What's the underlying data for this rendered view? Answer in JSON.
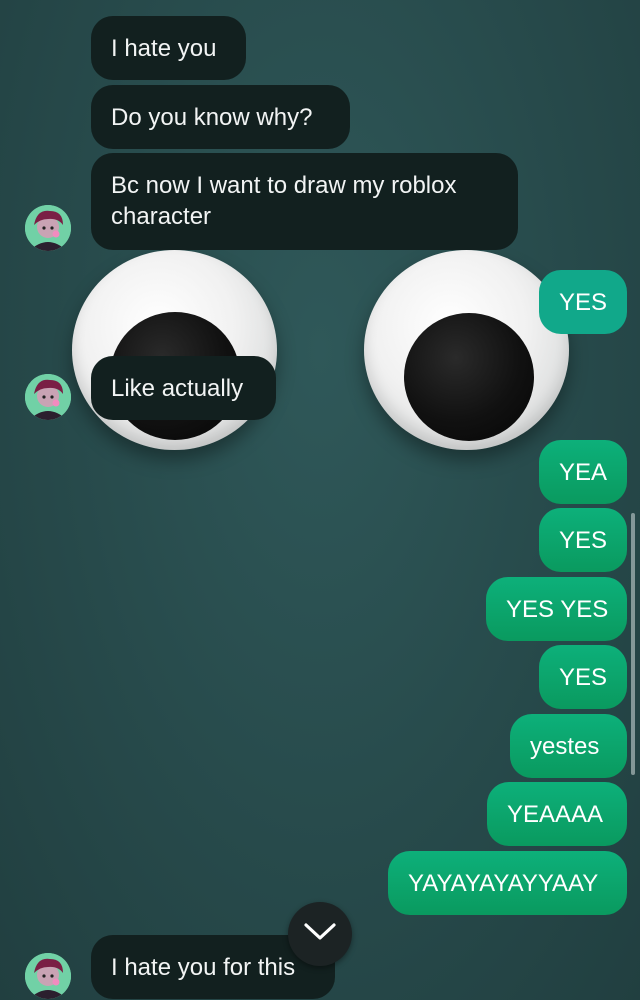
{
  "messages": [
    {
      "side": "in",
      "text": "I hate you"
    },
    {
      "side": "in",
      "text": "Do you know why?"
    },
    {
      "side": "in",
      "text": "Bc now I want to draw my roblox character"
    },
    {
      "side": "out",
      "text": "YES"
    },
    {
      "side": "in",
      "text": "Like actually"
    },
    {
      "side": "out",
      "text": "YEA"
    },
    {
      "side": "out",
      "text": "YES"
    },
    {
      "side": "out",
      "text": "YES YES"
    },
    {
      "side": "out",
      "text": "YES"
    },
    {
      "side": "out",
      "text": "yestes"
    },
    {
      "side": "out",
      "text": "YEAAAA"
    },
    {
      "side": "out",
      "text": "YAYAYAYAYYAAY"
    },
    {
      "side": "in",
      "text": "I hate you for this"
    }
  ],
  "icons": {
    "avatar": "user-avatar-icon",
    "scroll_down": "chevron-down-icon"
  },
  "colors": {
    "incoming_bubble": "#12201f",
    "outgoing_bubble": "#0a9a5f",
    "outgoing_bubble_teal": "#11a88a",
    "wallpaper": "#2a4e4f"
  }
}
